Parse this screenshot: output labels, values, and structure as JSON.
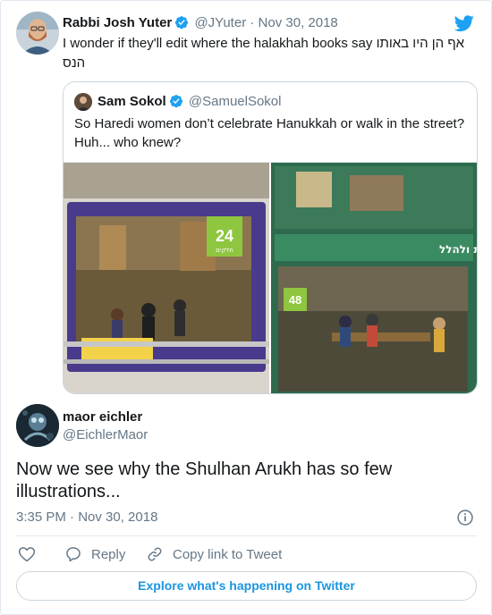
{
  "tweet": {
    "author_name": "Rabbi Josh Yuter",
    "author_handle": "@JYuter",
    "separator": " · ",
    "date": "Nov 30, 2018",
    "text_line1_en": "I wonder if they'll edit where the halakhah books say",
    "text_line1_he": "אף הן היו באותו",
    "text_line2_he": "הנס"
  },
  "quote": {
    "author_name": "Sam Sokol",
    "author_handle": "@SamuelSokol",
    "text": "So Haredi women don’t celebrate Hanukkah or walk in the street? Huh... who knew?",
    "image_left": {
      "badge": "24",
      "caption": "חלקים"
    },
    "image_right": {
      "badge": "48",
      "caption": "פאזל להודות ולהלל"
    }
  },
  "reply": {
    "author_name": "maor eichler",
    "author_handle": "@EichlerMaor",
    "text": "Now we see why the Shulhan Arukh has so few illustrations...",
    "time": "3:35 PM · Nov 30, 2018"
  },
  "actions": {
    "reply_label": "Reply",
    "copy_link_label": "Copy link to Tweet"
  },
  "explore_label": "Explore what's happening on Twitter",
  "icons": {
    "verified": "verified-badge-icon",
    "twitter": "twitter-bird-icon",
    "like": "heart-icon",
    "reply": "speech-bubble-icon",
    "copy": "link-icon",
    "info": "info-icon"
  },
  "colors": {
    "twitter_blue": "#1da1f2",
    "link_blue": "#1b95e0",
    "text": "#14171a",
    "muted": "#657786",
    "border": "#e1e8ed"
  }
}
